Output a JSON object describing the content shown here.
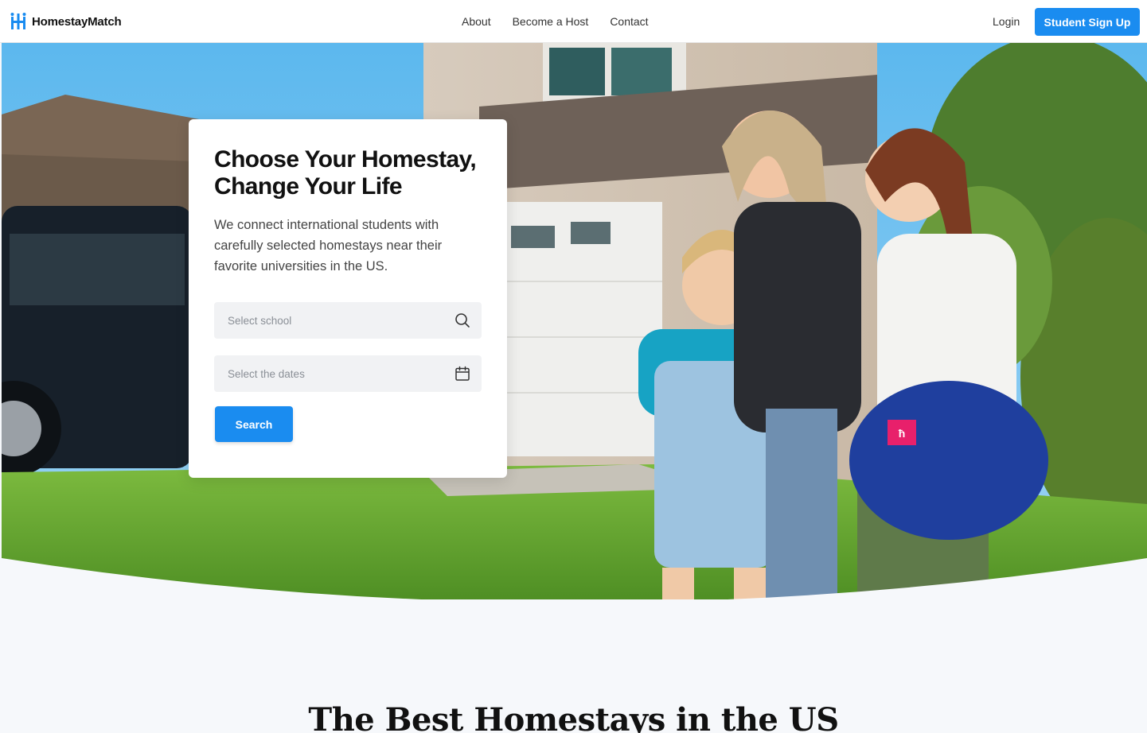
{
  "header": {
    "brand": "HomestayMatch",
    "nav": [
      "About",
      "Become a Host",
      "Contact"
    ],
    "login_label": "Login",
    "signup_label": "Student Sign Up",
    "accent_color": "#1a8cf0"
  },
  "hero": {
    "title_line1": "Choose Your Homestay,",
    "title_line2": "Change Your Life",
    "description": "We connect international students with carefully selected homestays near their favorite universities in the US.",
    "school_input": {
      "value": "",
      "placeholder": "Select school",
      "icon": "search-icon"
    },
    "dates_input": {
      "value": "",
      "placeholder": "Select the dates",
      "icon": "calendar-icon"
    },
    "search_label": "Search"
  },
  "section": {
    "title": "The Best Homestays in the US"
  }
}
